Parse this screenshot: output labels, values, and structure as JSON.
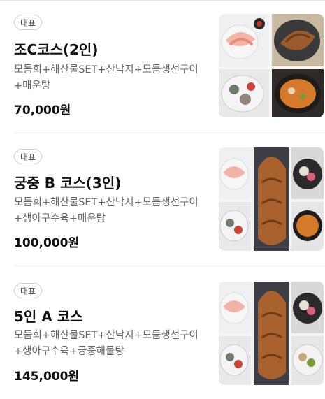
{
  "menu": {
    "items": [
      {
        "badge": "대표",
        "name": "조C코스(2인)",
        "description": "모듬회+해산물SET+산낙지+모듬생선구이+매운탕",
        "price": "70,000원",
        "image": "menu-photo-collage"
      },
      {
        "badge": "대표",
        "name": "궁중 B 코스(3인)",
        "description": "모듬회+해산물SET+산낙지+모듬생선구이+생아구수육+매운탕",
        "price": "100,000원",
        "image": "menu-photo-collage"
      },
      {
        "badge": "대표",
        "name": "5인 A 코스",
        "description": "모듬회+해산물SET+산낙지+모듬생선구이+생아구수육+궁중해물탕",
        "price": "145,000원",
        "image": "menu-photo-collage"
      }
    ]
  }
}
